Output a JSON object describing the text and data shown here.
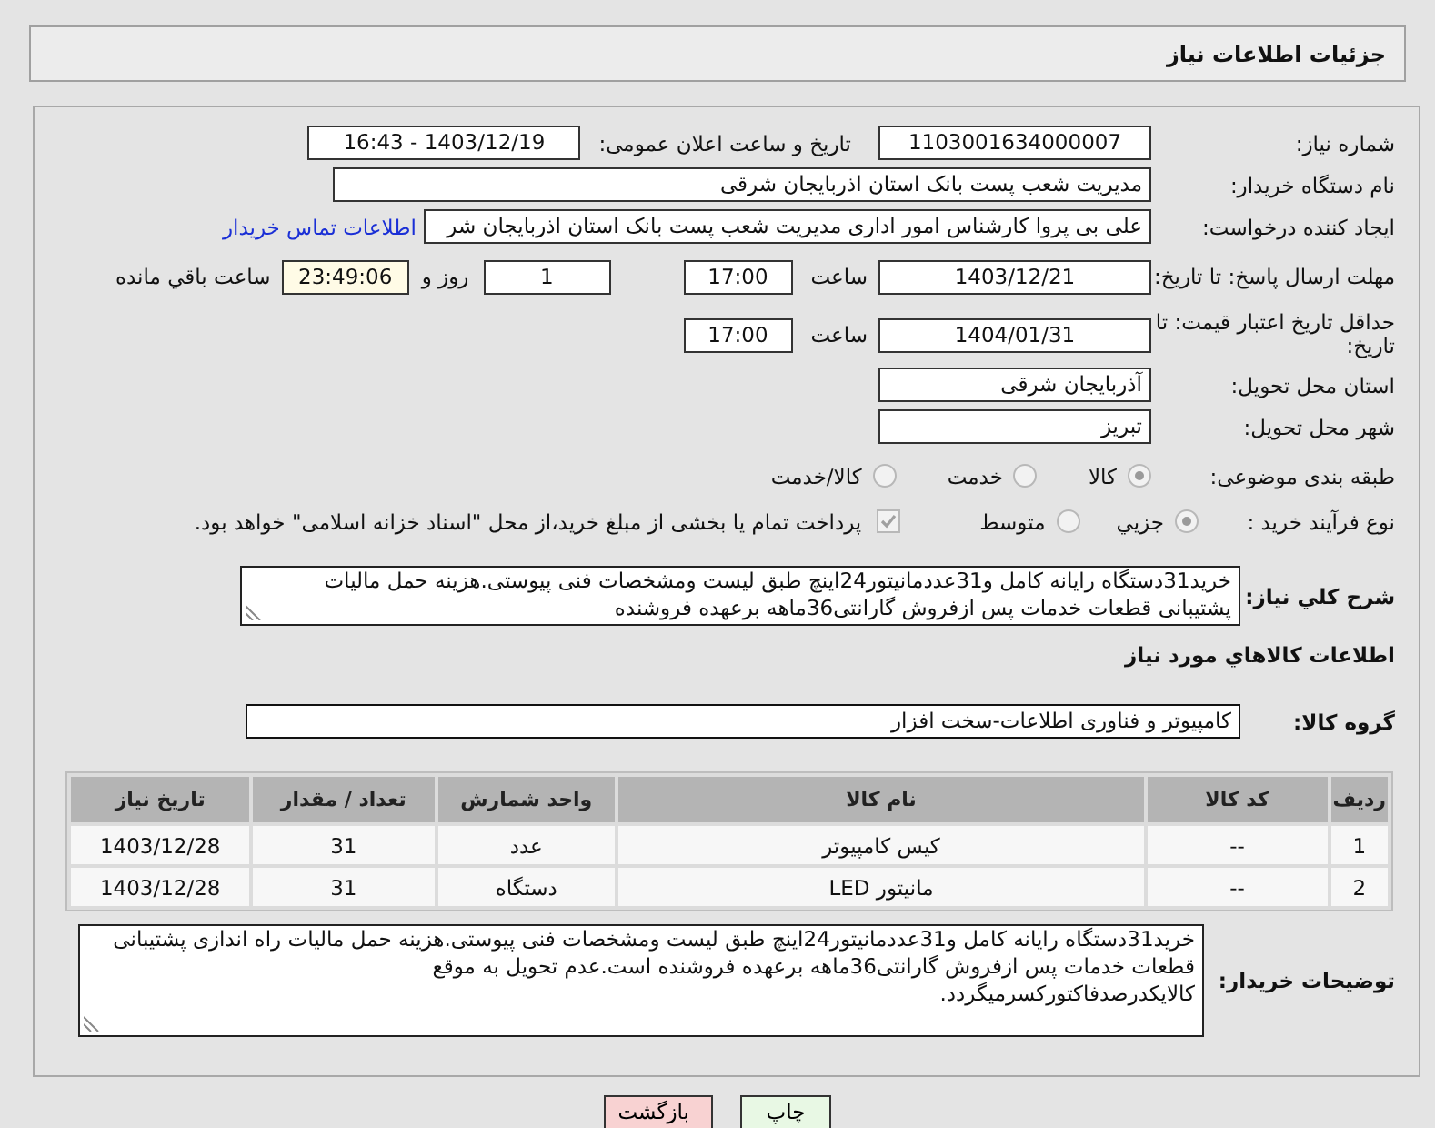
{
  "header": {
    "title": "جزئیات اطلاعات نیاز"
  },
  "need_number": {
    "label": "شماره نیاز:",
    "value": "1103001634000007"
  },
  "announce_datetime": {
    "label": "تاریخ و ساعت اعلان عمومی:",
    "value": "1403/12/19 - 16:43"
  },
  "buyer_org": {
    "label": "نام دستگاه خریدار:",
    "value": "مدیریت شعب پست بانک استان اذربایجان شرقی"
  },
  "requester": {
    "label": "ایجاد کننده درخواست:",
    "value": "علی بی پروا کارشناس امور اداری مدیریت شعب پست بانک استان اذربایجان شر",
    "contact_link": "اطلاعات تماس خریدار"
  },
  "reply_deadline": {
    "label": "مهلت ارسال پاسخ: تا تاریخ:",
    "date": "1403/12/21",
    "time_label": "ساعت",
    "time": "17:00",
    "days": "1",
    "days_label": "روز و",
    "remaining": "23:49:06",
    "remaining_label": "ساعت باقي مانده"
  },
  "price_validity": {
    "label": "حداقل تاریخ اعتبار قیمت: تا تاریخ:",
    "date": "1404/01/31",
    "time_label": "ساعت",
    "time": "17:00"
  },
  "delivery_province": {
    "label": "استان محل تحویل:",
    "value": "آذربایجان شرقی"
  },
  "delivery_city": {
    "label": "شهر محل تحویل:",
    "value": "تبریز"
  },
  "subject_category": {
    "label": "طبقه بندی موضوعی:",
    "options": [
      {
        "label": "کالا",
        "selected": true
      },
      {
        "label": "خدمت",
        "selected": false
      },
      {
        "label": "کالا/خدمت",
        "selected": false
      }
    ]
  },
  "purchase_process": {
    "label": "نوع فرآیند خرید :",
    "options": [
      {
        "label": "جزيي",
        "selected": true
      },
      {
        "label": "متوسط",
        "selected": false
      }
    ],
    "treasury_payment": {
      "checked": true,
      "text": "پرداخت تمام یا بخشی از مبلغ خرید،از محل \"اسناد خزانه اسلامی\" خواهد بود."
    }
  },
  "overall_description": {
    "label": "شرح کلي نیاز:",
    "value": "خرید31دستگاه رایانه کامل و31عددمانیتور24اینچ طبق لیست ومشخصات فنی پیوستی.هزینه حمل مالیات پشتیبانی قطعات خدمات پس ازفروش گارانتی36ماهه برعهده فروشنده"
  },
  "goods_section_title": "اطلاعات کالاهاي مورد نیاز",
  "goods_group": {
    "label": "گروه کالا:",
    "value": "کامپیوتر و فناوری اطلاعات-سخت افزار"
  },
  "goods_table": {
    "columns": [
      "ردیف",
      "کد کالا",
      "نام کالا",
      "واحد شمارش",
      "تعداد / مقدار",
      "تاریخ نیاز"
    ],
    "rows": [
      [
        "1",
        "--",
        "کیس کامپیوتر",
        "عدد",
        "31",
        "1403/12/28"
      ],
      [
        "2",
        "--",
        "مانیتور LED",
        "دستگاه",
        "31",
        "1403/12/28"
      ]
    ]
  },
  "buyer_notes": {
    "label": "توضیحات خریدار:",
    "value": "خرید31دستگاه رایانه کامل و31عددمانیتور24اینچ طبق لیست ومشخصات فنی پیوستی.هزینه حمل مالیات راه اندازی پشتیبانی قطعات خدمات پس ازفروش گارانتی36ماهه برعهده فروشنده است.عدم تحویل به موقع\nکالایکدرصدفاکتورکسرمیگردد."
  },
  "buttons": [
    {
      "label": "چاپ",
      "kind": "print"
    },
    {
      "label": "بازگشت",
      "kind": "back"
    }
  ]
}
